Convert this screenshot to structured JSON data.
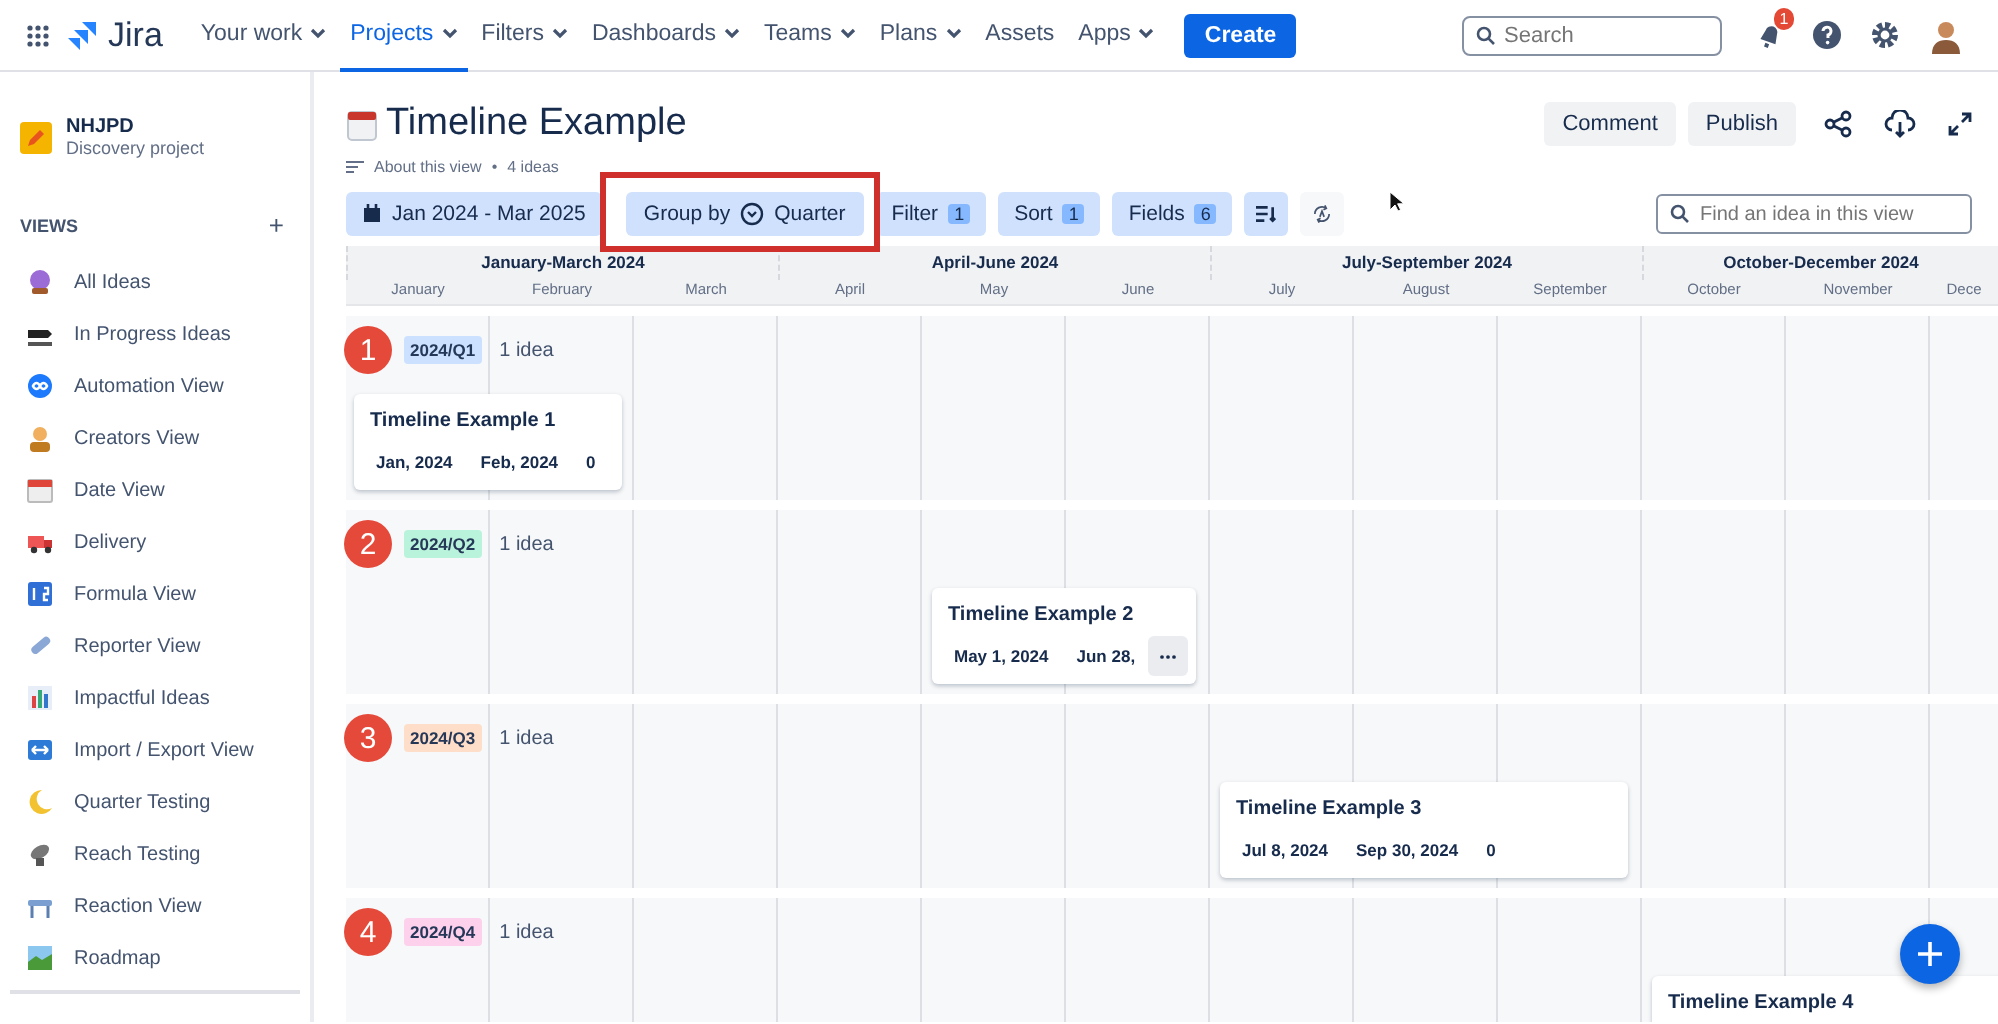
{
  "nav": {
    "product": "Jira",
    "items": [
      {
        "label": "Your work",
        "menu": true,
        "selected": false
      },
      {
        "label": "Projects",
        "menu": true,
        "selected": true
      },
      {
        "label": "Filters",
        "menu": true,
        "selected": false
      },
      {
        "label": "Dashboards",
        "menu": true,
        "selected": false
      },
      {
        "label": "Teams",
        "menu": true,
        "selected": false
      },
      {
        "label": "Plans",
        "menu": true,
        "selected": false
      },
      {
        "label": "Assets",
        "menu": false,
        "selected": false
      },
      {
        "label": "Apps",
        "menu": true,
        "selected": false
      }
    ],
    "create": "Create",
    "search": {
      "placeholder": "Search"
    },
    "notifications": "1"
  },
  "project": {
    "name": "NHJPD",
    "type": "Discovery project"
  },
  "views": {
    "title": "VIEWS",
    "add": "+",
    "items": [
      {
        "label": "All Ideas"
      },
      {
        "label": "In Progress Ideas"
      },
      {
        "label": "Automation View"
      },
      {
        "label": "Creators View"
      },
      {
        "label": "Date View"
      },
      {
        "label": "Delivery"
      },
      {
        "label": "Formula View"
      },
      {
        "label": "Reporter View"
      },
      {
        "label": "Impactful Ideas"
      },
      {
        "label": "Import / Export View"
      },
      {
        "label": "Quarter Testing"
      },
      {
        "label": "Reach Testing"
      },
      {
        "label": "Reaction View"
      },
      {
        "label": "Roadmap"
      }
    ]
  },
  "page": {
    "title": "Timeline Example",
    "about": "About this view",
    "separator": "•",
    "count": "4 ideas",
    "actions": [
      "Comment",
      "Publish"
    ]
  },
  "toolbar": {
    "date_range": "Jan 2024 - Mar 2025",
    "group_by": {
      "label": "Group by",
      "value": "Quarter",
      "highlighted": true
    },
    "controls": [
      {
        "label": "Filter",
        "count": "1"
      },
      {
        "label": "Sort",
        "count": "1"
      },
      {
        "label": "Fields",
        "count": "6"
      }
    ],
    "icon_buttons": [
      {
        "selected": true
      },
      {
        "selected": false
      }
    ],
    "search": {
      "placeholder": "Find an idea in this view"
    }
  },
  "timeline": {
    "quarters": [
      {
        "label": "January-March 2024",
        "months": [
          "January",
          "February",
          "March"
        ]
      },
      {
        "label": "April-June 2024",
        "months": [
          "April",
          "May",
          "June"
        ]
      },
      {
        "label": "July-September 2024",
        "months": [
          "July",
          "August",
          "September"
        ]
      },
      {
        "label": "October-December 2024",
        "months": [
          "October",
          "November",
          "Dece"
        ]
      }
    ],
    "groups": [
      {
        "marker": "1",
        "tag": "2024/Q1",
        "color": "#cce0ff",
        "count": "1 idea",
        "ideas": [
          {
            "title": "Timeline Example 1",
            "fields": [
              "Jan, 2024",
              "Feb, 2024",
              "0"
            ],
            "hovered": false
          }
        ]
      },
      {
        "marker": "2",
        "tag": "2024/Q2",
        "color": "#baf3db",
        "count": "1 idea",
        "ideas": [
          {
            "title": "Timeline Example 2",
            "fields": [
              "May 1, 2024",
              "Jun 28,"
            ],
            "hovered": true
          }
        ]
      },
      {
        "marker": "3",
        "tag": "2024/Q3",
        "color": "#fedec8",
        "count": "1 idea",
        "ideas": [
          {
            "title": "Timeline Example 3",
            "fields": [
              "Jul 8, 2024",
              "Sep 30, 2024",
              "0"
            ],
            "hovered": false
          }
        ]
      },
      {
        "marker": "4",
        "tag": "2024/Q4",
        "color": "#fdd0ec",
        "count": "1 idea",
        "ideas": [
          {
            "title": "Timeline Example 4"
          }
        ]
      }
    ]
  }
}
